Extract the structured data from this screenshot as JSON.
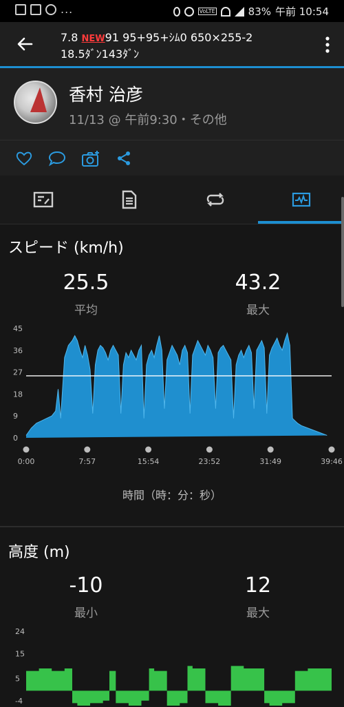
{
  "status_bar": {
    "battery": "83%",
    "time": "午前 10:54",
    "signal_label": "VoLTE"
  },
  "app_bar": {
    "line1_prefix": "7.8 ",
    "line1_badge": "NEW",
    "line1_suffix": "91 95+95+ｼﾑ0  650×255-2",
    "line2": "18.5ﾀﾞﾝ143ﾀﾞﾝ"
  },
  "profile": {
    "name": "香村 治彦",
    "subtitle": "11/13 @ 午前9:30・その他"
  },
  "actions": [
    "heart-icon",
    "comment-icon",
    "add-photo-icon",
    "share-icon"
  ],
  "tabs": [
    {
      "name": "tab-overview",
      "icon": "map-icon"
    },
    {
      "name": "tab-stats",
      "icon": "list-icon"
    },
    {
      "name": "tab-laps",
      "icon": "loop-icon"
    },
    {
      "name": "tab-charts",
      "icon": "chart-icon",
      "selected": true
    }
  ],
  "speed": {
    "title": "スピード (km/h)",
    "avg_value": "25.5",
    "avg_label": "平均",
    "max_value": "43.2",
    "max_label": "最大",
    "x_caption": "時間（時：分：秒）",
    "chart_data": {
      "type": "area",
      "y_ticks": [
        "45",
        "36",
        "27",
        "18",
        "9",
        "0"
      ],
      "ylim": [
        0,
        45
      ],
      "x_ticks": [
        "0:00",
        "7:57",
        "15:54",
        "23:52",
        "31:49",
        "39:46"
      ],
      "xlim_seconds": [
        0,
        2386
      ],
      "reference_line": 25.5,
      "fill_color": "#1f8fcf",
      "line_color": "#4fb6ec",
      "series": [
        {
          "x": [
            0,
            40,
            80,
            120,
            160,
            200,
            230,
            250,
            270,
            290,
            300,
            330,
            360,
            380,
            400,
            420,
            440,
            460,
            480,
            500,
            520,
            540,
            560,
            580,
            600,
            620,
            640,
            660,
            680,
            700,
            720,
            740,
            760,
            780,
            800,
            820,
            840,
            860,
            880,
            900,
            920,
            940,
            960,
            980,
            1000,
            1020,
            1040,
            1060,
            1080,
            1100,
            1120,
            1140,
            1160,
            1180,
            1200,
            1220,
            1240,
            1260,
            1280,
            1300,
            1320,
            1340,
            1360,
            1380,
            1400,
            1420,
            1440,
            1460,
            1480,
            1500,
            1520,
            1540,
            1560,
            1580,
            1600,
            1620,
            1640,
            1660,
            1680,
            1700,
            1720,
            1740,
            1760,
            1780,
            1800,
            1820,
            1840,
            1860,
            1880,
            1900,
            1920,
            1940,
            1960,
            1980,
            2000,
            2020,
            2040,
            2060,
            2080,
            2100,
            2120,
            2150,
            2200,
            2250,
            2300,
            2350,
            2386
          ],
          "y": [
            1,
            4,
            6,
            7,
            8,
            9,
            11,
            20,
            8,
            25,
            33,
            38,
            40,
            42,
            40,
            36,
            33,
            38,
            34,
            28,
            10,
            30,
            36,
            38,
            37,
            35,
            32,
            36,
            38,
            36,
            34,
            10,
            30,
            35,
            33,
            36,
            34,
            32,
            36,
            38,
            8,
            30,
            34,
            36,
            33,
            38,
            42,
            36,
            12,
            32,
            35,
            38,
            36,
            34,
            30,
            36,
            38,
            35,
            10,
            34,
            37,
            40,
            38,
            36,
            34,
            38,
            36,
            33,
            12,
            35,
            37,
            38,
            36,
            34,
            32,
            8,
            30,
            34,
            36,
            33,
            36,
            38,
            35,
            12,
            36,
            38,
            40,
            37,
            10,
            34,
            37,
            39,
            41,
            38,
            36,
            40,
            43,
            38,
            8,
            7,
            6,
            5,
            4,
            3,
            2,
            1
          ]
        }
      ]
    }
  },
  "altitude": {
    "title": "高度 (m)",
    "min_value": "-10",
    "min_label": "最小",
    "max_value": "12",
    "max_label": "最大",
    "chart_data": {
      "type": "area",
      "y_ticks": [
        "24",
        "15",
        "5",
        "-4"
      ],
      "ylim": [
        -6,
        24
      ],
      "baseline": 0,
      "fill_color": "#37c24a",
      "series": [
        {
          "x": [
            0,
            100,
            200,
            300,
            360,
            400,
            500,
            600,
            650,
            700,
            800,
            900,
            960,
            1000,
            1100,
            1200,
            1260,
            1300,
            1400,
            1500,
            1600,
            1700,
            1800,
            1860,
            1900,
            2000,
            2100,
            2200,
            2300,
            2386
          ],
          "y": [
            8,
            9,
            8,
            9,
            -5,
            -6,
            -5,
            -4,
            8,
            -5,
            -6,
            -4,
            9,
            8,
            -6,
            -5,
            10,
            9,
            -5,
            -6,
            10,
            9,
            9,
            -5,
            -6,
            -5,
            8,
            9,
            9,
            8
          ]
        }
      ]
    }
  }
}
